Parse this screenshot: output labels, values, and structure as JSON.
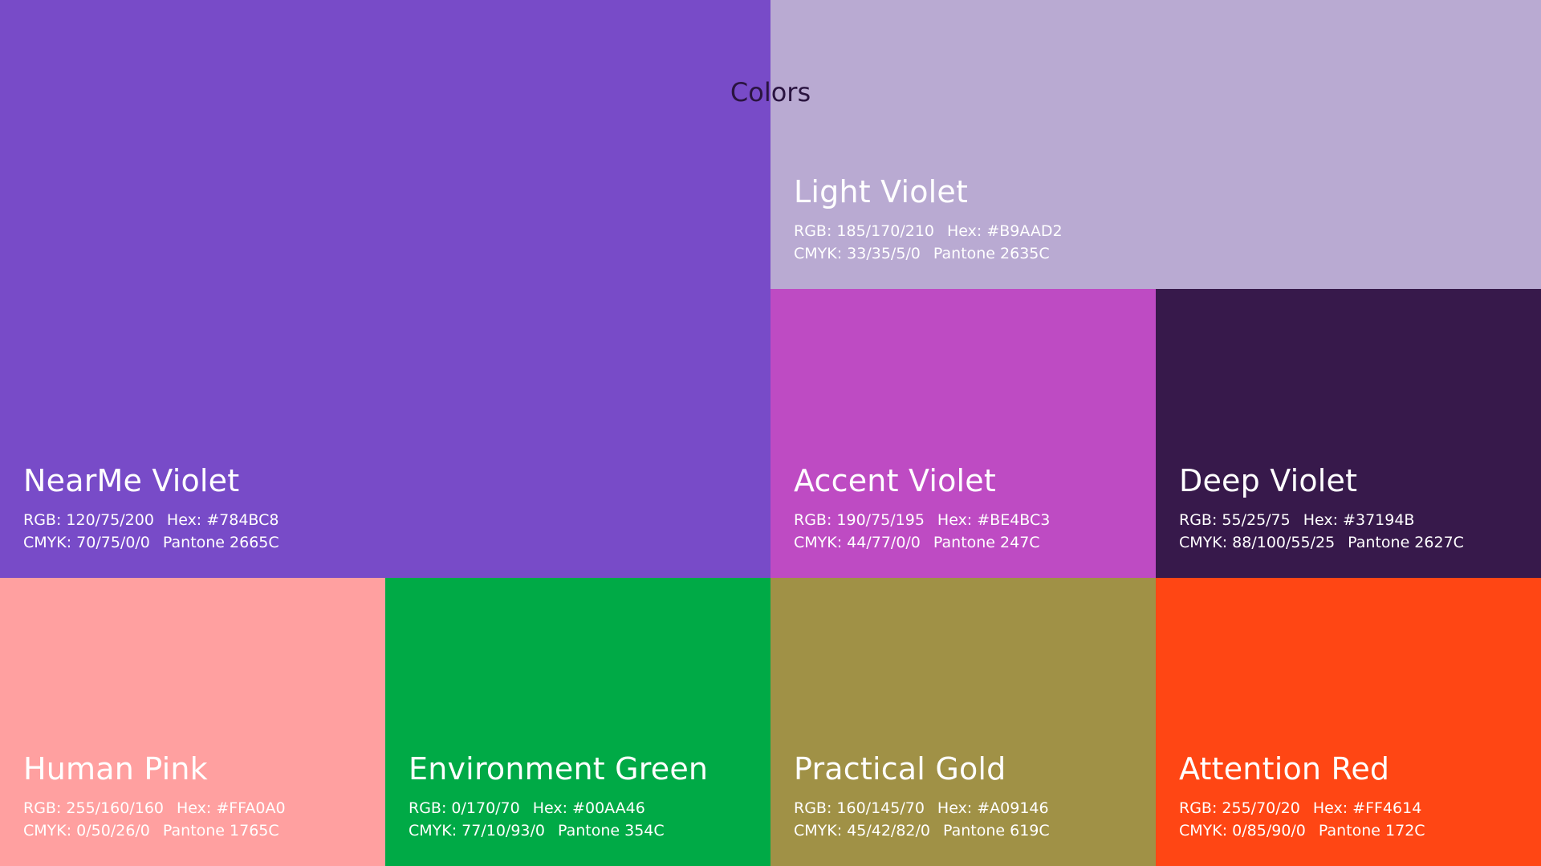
{
  "title": "Colors",
  "swatches": [
    {
      "name": "NearMe Violet",
      "rgb": "RGB: 120/75/200",
      "hex": "Hex: #784BC8",
      "cmyk": "CMYK: 70/75/0/0",
      "pantone": "Pantone 2665C",
      "color": "#784BC8"
    },
    {
      "name": "Light Violet",
      "rgb": "RGB: 185/170/210",
      "hex": "Hex: #B9AAD2",
      "cmyk": "CMYK: 33/35/5/0",
      "pantone": "Pantone 2635C",
      "color": "#B9AAD2"
    },
    {
      "name": "Accent Violet",
      "rgb": "RGB: 190/75/195",
      "hex": "Hex: #BE4BC3",
      "cmyk": "CMYK: 44/77/0/0",
      "pantone": "Pantone 247C",
      "color": "#BE4BC3"
    },
    {
      "name": "Deep Violet",
      "rgb": "RGB: 55/25/75",
      "hex": "Hex: #37194B",
      "cmyk": "CMYK: 88/100/55/25",
      "pantone": "Pantone 2627C",
      "color": "#37194B"
    },
    {
      "name": "Human Pink",
      "rgb": "RGB: 255/160/160",
      "hex": "Hex: #FFA0A0",
      "cmyk": "CMYK: 0/50/26/0",
      "pantone": "Pantone 1765C",
      "color": "#FFA0A0"
    },
    {
      "name": "Environment Green",
      "rgb": "RGB: 0/170/70",
      "hex": "Hex: #00AA46",
      "cmyk": "CMYK: 77/10/93/0",
      "pantone": "Pantone 354C",
      "color": "#00AA46"
    },
    {
      "name": "Practical Gold",
      "rgb": "RGB: 160/145/70",
      "hex": "Hex: #A09146",
      "cmyk": "CMYK: 45/42/82/0",
      "pantone": "Pantone 619C",
      "color": "#A09146"
    },
    {
      "name": "Attention Red",
      "rgb": "RGB: 255/70/20",
      "hex": "Hex: #FF4614",
      "cmyk": "CMYK: 0/85/90/0",
      "pantone": "Pantone 172C",
      "color": "#FF4614"
    }
  ]
}
